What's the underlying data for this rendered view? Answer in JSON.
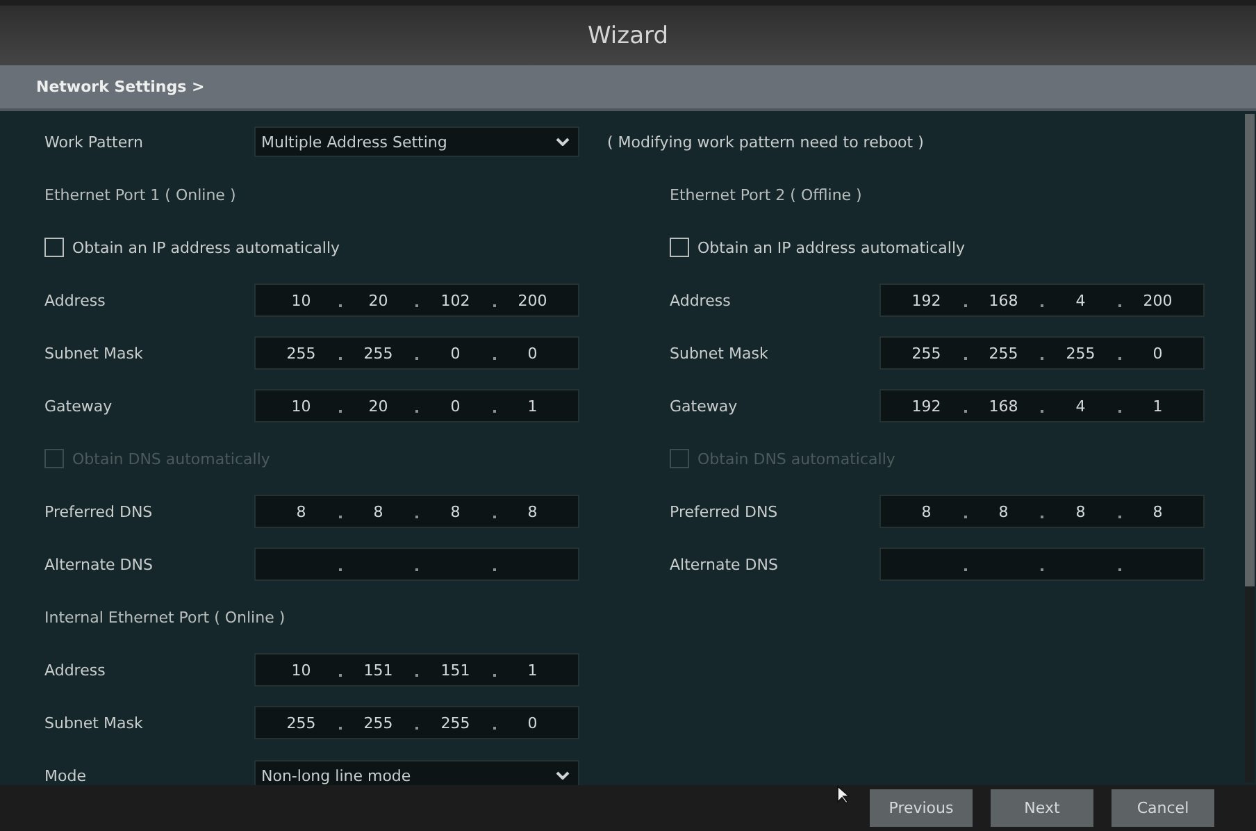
{
  "window": {
    "title": "Wizard"
  },
  "section": {
    "title": "Network Settings >"
  },
  "work_pattern": {
    "label": "Work Pattern",
    "value": "Multiple Address Setting",
    "note": "( Modifying work pattern need to reboot )"
  },
  "columns": [
    {
      "rows": [
        {
          "kind": "heading",
          "label": "Ethernet Port 1 ( Online )"
        },
        {
          "kind": "checkbox",
          "label": "Obtain an IP address automatically",
          "checked": false,
          "disabled": false
        },
        {
          "kind": "ip",
          "label": "Address",
          "octets": [
            "10",
            "20",
            "102",
            "200"
          ]
        },
        {
          "kind": "ip",
          "label": "Subnet Mask",
          "octets": [
            "255",
            "255",
            "0",
            "0"
          ]
        },
        {
          "kind": "ip",
          "label": "Gateway",
          "octets": [
            "10",
            "20",
            "0",
            "1"
          ]
        },
        {
          "kind": "checkbox",
          "label": "Obtain DNS automatically",
          "checked": false,
          "disabled": true
        },
        {
          "kind": "ip",
          "label": "Preferred DNS",
          "octets": [
            "8",
            "8",
            "8",
            "8"
          ]
        },
        {
          "kind": "ip",
          "label": "Alternate DNS"
        },
        {
          "kind": "heading",
          "label": "Internal Ethernet Port ( Online )"
        },
        {
          "kind": "ip",
          "label": "Address",
          "octets": [
            "10",
            "151",
            "151",
            "1"
          ]
        },
        {
          "kind": "ip",
          "label": "Subnet Mask",
          "octets": [
            "255",
            "255",
            "255",
            "0"
          ]
        },
        {
          "kind": "select",
          "label": "Mode",
          "value": "Non-long line mode"
        }
      ]
    },
    {
      "rows": [
        {
          "kind": "heading",
          "label": "Ethernet Port 2 ( Offline )"
        },
        {
          "kind": "checkbox",
          "label": "Obtain an IP address automatically",
          "checked": false,
          "disabled": false
        },
        {
          "kind": "ip",
          "label": "Address",
          "octets": [
            "192",
            "168",
            "4",
            "200"
          ]
        },
        {
          "kind": "ip",
          "label": "Subnet Mask",
          "octets": [
            "255",
            "255",
            "255",
            "0"
          ]
        },
        {
          "kind": "ip",
          "label": "Gateway",
          "octets": [
            "192",
            "168",
            "4",
            "1"
          ]
        },
        {
          "kind": "checkbox",
          "label": "Obtain DNS automatically",
          "checked": false,
          "disabled": true
        },
        {
          "kind": "ip",
          "label": "Preferred DNS",
          "octets": [
            "8",
            "8",
            "8",
            "8"
          ]
        },
        {
          "kind": "ip",
          "label": "Alternate DNS"
        }
      ]
    }
  ],
  "buttons": [
    "Previous",
    "Next",
    "Cancel"
  ]
}
